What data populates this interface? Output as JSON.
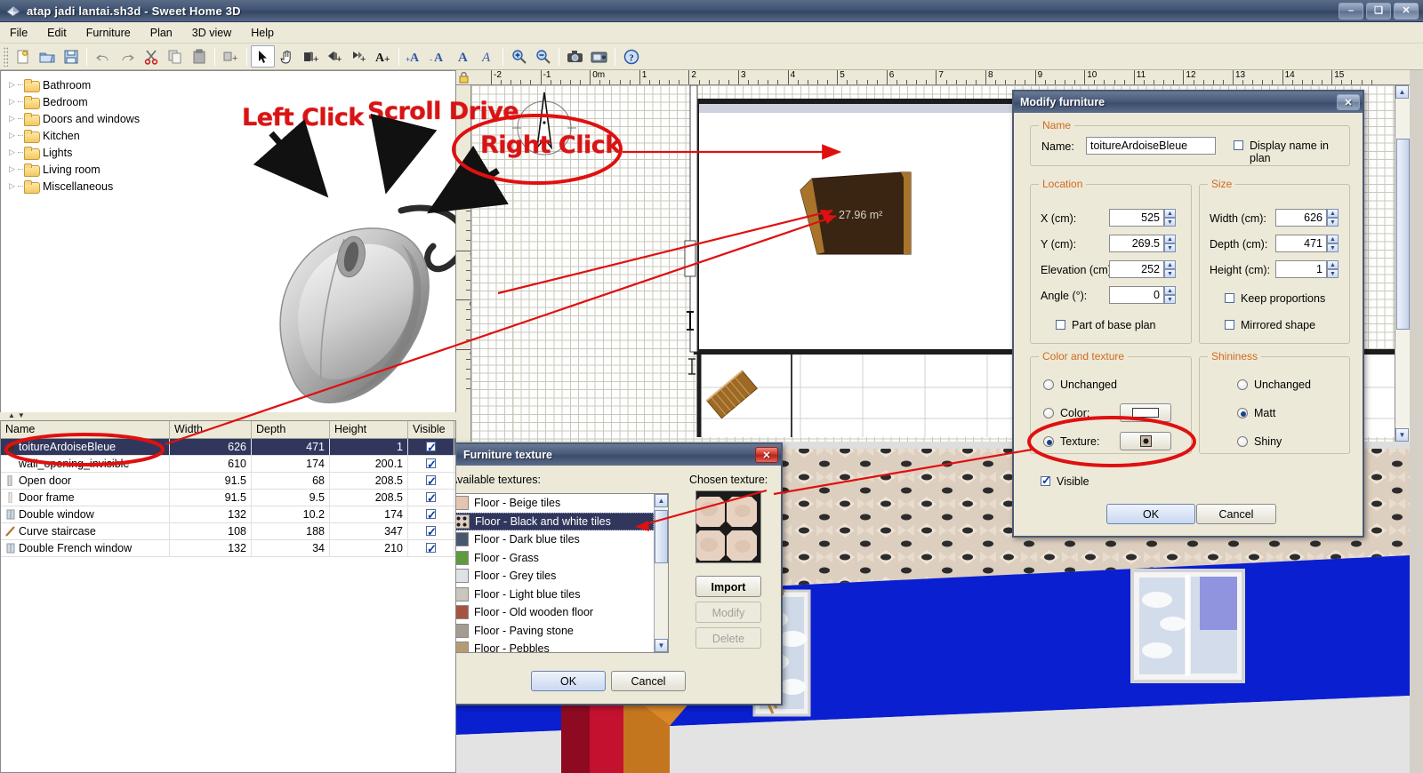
{
  "window": {
    "title": "atap jadi lantai.sh3d - Sweet Home 3D",
    "minimize_label": "–",
    "maximize_label": "❑",
    "close_label": "✕"
  },
  "menubar": {
    "items": [
      "File",
      "Edit",
      "Furniture",
      "Plan",
      "3D view",
      "Help"
    ]
  },
  "toolbar": {
    "items": [
      {
        "name": "new-home-icon",
        "tooltip": "New home"
      },
      {
        "name": "open-icon",
        "tooltip": "Open"
      },
      {
        "name": "save-icon",
        "tooltip": "Save"
      },
      {
        "name": "undo-icon",
        "tooltip": "Undo"
      },
      {
        "name": "redo-icon",
        "tooltip": "Redo"
      },
      {
        "name": "cut-icon",
        "tooltip": "Cut"
      },
      {
        "name": "copy-icon",
        "tooltip": "Copy"
      },
      {
        "name": "paste-icon",
        "tooltip": "Paste"
      },
      {
        "name": "add-furniture-icon",
        "tooltip": "Add furniture"
      },
      {
        "name": "select-pointer-icon",
        "tooltip": "Select"
      },
      {
        "name": "pan-hand-icon",
        "tooltip": "Pan"
      },
      {
        "name": "create-walls-icon",
        "tooltip": "Create walls"
      },
      {
        "name": "create-rooms-icon",
        "tooltip": "Create rooms"
      },
      {
        "name": "create-dimensions-icon",
        "tooltip": "Create dimensions"
      },
      {
        "name": "add-text-icon",
        "tooltip": "Add texts"
      },
      {
        "name": "increase-text-size-icon",
        "tooltip": "Increase text size"
      },
      {
        "name": "decrease-text-size-icon",
        "tooltip": "Decrease text size"
      },
      {
        "name": "bold-icon",
        "tooltip": "Toggle bold style"
      },
      {
        "name": "italic-icon",
        "tooltip": "Toggle italic style"
      },
      {
        "name": "zoom-in-icon",
        "tooltip": "Zoom in"
      },
      {
        "name": "zoom-out-icon",
        "tooltip": "Zoom out"
      },
      {
        "name": "photo-create-icon",
        "tooltip": "Create photo"
      },
      {
        "name": "video-create-icon",
        "tooltip": "Create video"
      },
      {
        "name": "help-icon",
        "tooltip": "Help"
      }
    ],
    "selected_index": 9
  },
  "catalog": {
    "categories": [
      {
        "label": "Bathroom"
      },
      {
        "label": "Bedroom"
      },
      {
        "label": "Doors and windows"
      },
      {
        "label": "Kitchen"
      },
      {
        "label": "Lights"
      },
      {
        "label": "Living room"
      },
      {
        "label": "Miscellaneous"
      }
    ],
    "expander_glyph": "▷"
  },
  "annotations": {
    "left_click": "Left Click",
    "scroll_drive": "Scroll Drive",
    "right_click": "Right Click"
  },
  "furniture_table": {
    "columns": [
      "Name",
      "Width",
      "Depth",
      "Height",
      "Visible"
    ],
    "rows": [
      {
        "name": "toitureArdoiseBleue",
        "width": "626",
        "depth": "471",
        "height": "1",
        "visible": true,
        "selected": true
      },
      {
        "name": "wall_opening_invisible",
        "width": "610",
        "depth": "174",
        "height": "200.1",
        "visible": true,
        "selected": false
      },
      {
        "name": "Open door",
        "width": "91.5",
        "depth": "68",
        "height": "208.5",
        "visible": true,
        "selected": false
      },
      {
        "name": "Door frame",
        "width": "91.5",
        "depth": "9.5",
        "height": "208.5",
        "visible": true,
        "selected": false
      },
      {
        "name": "Double window",
        "width": "132",
        "depth": "10.2",
        "height": "174",
        "visible": true,
        "selected": false
      },
      {
        "name": "Curve staircase",
        "width": "108",
        "depth": "188",
        "height": "347",
        "visible": true,
        "selected": false
      },
      {
        "name": "Double French window",
        "width": "132",
        "depth": "34",
        "height": "210",
        "visible": true,
        "selected": false
      }
    ]
  },
  "plan": {
    "ruler_h_labels": [
      "-2",
      "-1",
      "0m",
      "1",
      "2",
      "3",
      "4",
      "5",
      "6",
      "7",
      "8",
      "9",
      "10",
      "11",
      "12",
      "13",
      "14",
      "15"
    ],
    "ruler_v_labels": [
      "3",
      "4",
      "5",
      "6"
    ],
    "room_area_label": "27.96 m²",
    "compass_name": "compass"
  },
  "modify_furniture_dialog": {
    "title": "Modify furniture",
    "close_label": "✕",
    "name_group": {
      "legend": "Name",
      "name_label": "Name:",
      "name_value": "toitureArdoiseBleue",
      "display_name_label": "Display name in plan",
      "display_name_checked": false
    },
    "location_group": {
      "legend": "Location",
      "fields": [
        {
          "label": "X (cm):",
          "value": "525"
        },
        {
          "label": "Y (cm):",
          "value": "269.5"
        },
        {
          "label": "Elevation (cm):",
          "value": "252"
        },
        {
          "label": "Angle (°):",
          "value": "0"
        }
      ],
      "base_plan_label": "Part of base plan",
      "base_plan_checked": false
    },
    "size_group": {
      "legend": "Size",
      "fields": [
        {
          "label": "Width (cm):",
          "value": "626"
        },
        {
          "label": "Depth (cm):",
          "value": "471"
        },
        {
          "label": "Height (cm):",
          "value": "1"
        }
      ],
      "keep_proportions_label": "Keep proportions",
      "keep_proportions_checked": false,
      "mirrored_label": "Mirrored shape",
      "mirrored_checked": false
    },
    "color_texture_group": {
      "legend": "Color and texture",
      "unchanged_label": "Unchanged",
      "color_label": "Color:",
      "texture_label": "Texture:",
      "selected": "texture"
    },
    "shininess_group": {
      "legend": "Shininess",
      "options": [
        "Unchanged",
        "Matt",
        "Shiny"
      ],
      "selected": "Matt"
    },
    "visible_label": "Visible",
    "visible_checked": true,
    "ok_label": "OK",
    "cancel_label": "Cancel"
  },
  "furniture_texture_dialog": {
    "title": "Furniture texture",
    "close_label": "✕",
    "available_label": "Available textures:",
    "chosen_label": "Chosen texture:",
    "textures": [
      {
        "label": "Floor - Beige tiles",
        "swatch": "#e4c5b0",
        "selected": false
      },
      {
        "label": "Floor - Black and white tiles",
        "swatch": "#ddd0c2",
        "selected": true
      },
      {
        "label": "Floor - Dark blue tiles",
        "swatch": "#46586e",
        "selected": false
      },
      {
        "label": "Floor - Grass",
        "swatch": "#5e9b3f",
        "selected": false
      },
      {
        "label": "Floor - Grey tiles",
        "swatch": "#dfe2e4",
        "selected": false
      },
      {
        "label": "Floor - Light blue tiles",
        "swatch": "#c9c6bd",
        "selected": false
      },
      {
        "label": "Floor - Old wooden floor",
        "swatch": "#a65440",
        "selected": false
      },
      {
        "label": "Floor - Paving stone",
        "swatch": "#a49c90",
        "selected": false
      },
      {
        "label": "Floor - Pebbles",
        "swatch": "#b59b74",
        "selected": false
      }
    ],
    "import_label": "Import",
    "modify_label": "Modify",
    "delete_label": "Delete",
    "ok_label": "OK",
    "cancel_label": "Cancel"
  },
  "colors": {
    "title_bar": "#3f5373",
    "dialog_face": "#ece9d8",
    "group_legend": "#d2691e",
    "selection": "#31375c",
    "annotation_red": "#d81414",
    "highlight_red": "#e01010",
    "wall_red": "#c4112f",
    "wall_blue": "#0a1fd0",
    "stair_orange": "#d98827"
  }
}
